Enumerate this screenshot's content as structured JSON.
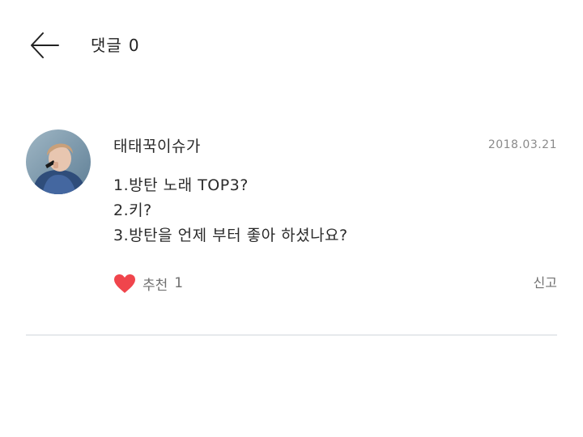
{
  "header": {
    "back_icon": "arrow-left-icon",
    "title": "댓글",
    "count": "0"
  },
  "comment": {
    "avatar_icon": "user-avatar",
    "author": "태태꾹이슈가",
    "date": "2018.03.21",
    "lines": [
      "1.방탄 노래 TOP3?",
      "2.키?",
      "3.방탄을 언제 부터 좋아 하셨나요?"
    ],
    "like_icon": "heart-icon",
    "like_color": "#f0454c",
    "like_label": "추천",
    "like_count": "1",
    "report_label": "신고"
  }
}
